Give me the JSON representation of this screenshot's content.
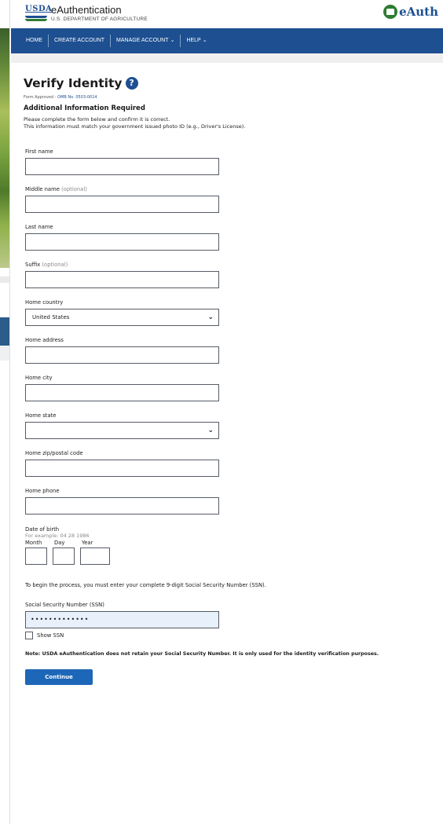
{
  "header": {
    "usda_label": "USDA",
    "title": "eAuthentication",
    "subtitle": "U.S. DEPARTMENT OF AGRICULTURE",
    "brand": "eAuth"
  },
  "nav": {
    "items": [
      {
        "label": "HOME"
      },
      {
        "label": "CREATE ACCOUNT"
      },
      {
        "label": "MANAGE ACCOUNT"
      },
      {
        "label": "HELP"
      }
    ]
  },
  "page": {
    "title": "Verify Identity",
    "help_glyph": "?",
    "form_approved_prefix": "Form Approved - ",
    "omb_link": "OMB No. 0503-0014",
    "subheading": "Additional Information Required",
    "instruction_1": "Please complete the form below and confirm it is correct.",
    "instruction_2": "This information must match your government issued photo ID (e.g., Driver's License)."
  },
  "form": {
    "first_name": {
      "label": "First name",
      "value": ""
    },
    "middle_name": {
      "label": "Middle name",
      "optional": "(optional)",
      "value": ""
    },
    "last_name": {
      "label": "Last name",
      "value": ""
    },
    "suffix": {
      "label": "Suffix",
      "optional": "(optional)",
      "value": ""
    },
    "home_country": {
      "label": "Home country",
      "value": "United States"
    },
    "home_address": {
      "label": "Home address",
      "value": ""
    },
    "home_city": {
      "label": "Home city",
      "value": ""
    },
    "home_state": {
      "label": "Home state",
      "value": ""
    },
    "home_zip": {
      "label": "Home zip/postal code",
      "value": ""
    },
    "home_phone": {
      "label": "Home phone",
      "value": ""
    },
    "dob": {
      "label": "Date of birth",
      "hint": "For example: 04 28 1986",
      "month_label": "Month",
      "day_label": "Day",
      "year_label": "Year"
    },
    "ssn_intro": "To begin the process, you must enter your complete 9-digit Social Security Number (SSN).",
    "ssn": {
      "label": "Social Security Number (SSN)",
      "value": "•••••••••••••"
    },
    "show_ssn_label": "Show SSN",
    "show_ssn_checked": false,
    "note": "Note: USDA eAuthentication does not retain your Social Security Number. It is only used for the identity verification purposes.",
    "continue_label": "Continue"
  },
  "colors": {
    "nav_bg": "#1d4f91",
    "primary_button": "#1d67b8",
    "ssn_field_bg": "#e7f0fb"
  }
}
